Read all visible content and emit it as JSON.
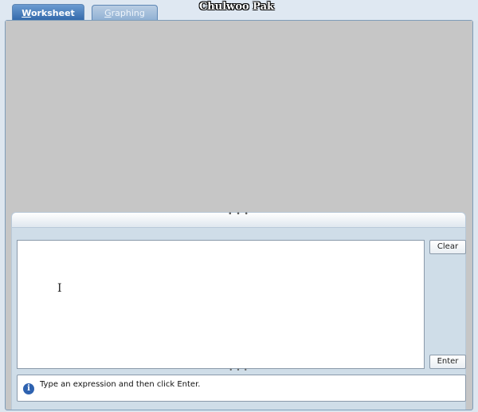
{
  "app": {
    "title": "Chulwoo Pak"
  },
  "tabs": [
    {
      "label_first": "W",
      "label_rest": "orksheet",
      "active": true
    },
    {
      "label_first": "G",
      "label_rest": "raphing",
      "active": false
    }
  ],
  "input": {
    "clear_label": "Clear",
    "enter_label": "Enter"
  },
  "status": {
    "message": "Type an expression and then click Enter."
  },
  "icons": {
    "status": "info-icon",
    "cursor": "ibeam-cursor-icon"
  },
  "colors": {
    "accent": "#2e65a8",
    "output_background": "#c6c6c6"
  }
}
